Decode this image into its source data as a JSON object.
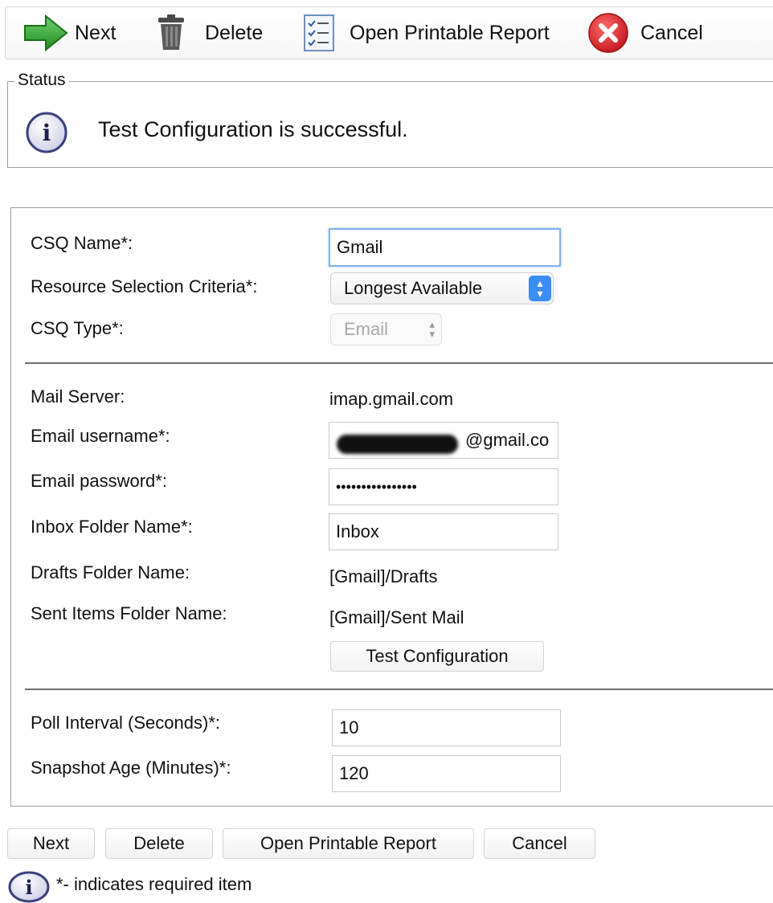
{
  "toolbar": {
    "next_label": "Next",
    "delete_label": "Delete",
    "report_label": "Open Printable Report",
    "cancel_label": "Cancel"
  },
  "status": {
    "legend": "Status",
    "message": "Test Configuration is successful."
  },
  "form": {
    "csq_name_label": "CSQ Name*:",
    "csq_name_value": "Gmail",
    "resource_label": "Resource Selection Criteria*:",
    "resource_value": "Longest Available",
    "csq_type_label": "CSQ Type*:",
    "csq_type_value": "Email",
    "mail_server_label": "Mail Server:",
    "mail_server_value": "imap.gmail.com",
    "email_username_label": "Email username*:",
    "email_username_value": "a@gmail.co",
    "email_username_visible_suffix": "@gmail.co",
    "email_password_label": "Email password*:",
    "email_password_value": "••••••••••••••••",
    "inbox_label": "Inbox Folder Name*:",
    "inbox_value": "Inbox",
    "drafts_label": "Drafts Folder Name:",
    "drafts_value": "[Gmail]/Drafts",
    "sent_label": "Sent Items Folder Name:",
    "sent_value": "[Gmail]/Sent Mail",
    "test_config_label": "Test Configuration",
    "poll_label": "Poll Interval (Seconds)*:",
    "poll_value": "10",
    "snapshot_label": "Snapshot Age (Minutes)*:",
    "snapshot_value": "120"
  },
  "bottom": {
    "next_label": "Next",
    "delete_label": "Delete",
    "report_label": "Open Printable Report",
    "cancel_label": "Cancel",
    "required_note": "*- indicates required item"
  },
  "icons": {
    "next": "arrow-right-icon",
    "delete": "trash-icon",
    "report": "checklist-icon",
    "cancel": "cancel-x-icon",
    "info": "info-icon"
  },
  "colors": {
    "next_green": "#3aa83a",
    "cancel_red": "#d7262b",
    "focus_blue": "#7fb2e6",
    "select_blue": "#3b8ef5"
  }
}
